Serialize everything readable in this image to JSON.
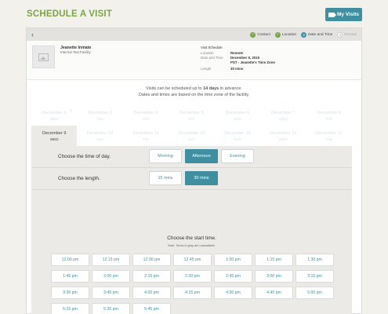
{
  "header": {
    "title": "SCHEDULE A VISIT",
    "my_visits_label": "My Visits"
  },
  "steps": [
    {
      "label": "Contact",
      "state": "done",
      "marker": "✓"
    },
    {
      "label": "Location",
      "state": "done",
      "marker": "✓"
    },
    {
      "label": "Date and Time",
      "state": "current",
      "marker": "3"
    },
    {
      "label": "Review",
      "state": "todo",
      "marker": "4"
    }
  ],
  "inmate": {
    "name": "Jeanette Inmate",
    "facility": "Internal Test Facility"
  },
  "visit_schedule": {
    "title": "Visit Schedule",
    "location_label": "Location",
    "location_value": "Remote",
    "datetime_label": "Date and Time",
    "date_value": "December 9, 2015",
    "tz_value": "PST - Jeanette's Time Zone",
    "length_label": "Length",
    "length_value": "30 mins"
  },
  "info": {
    "line1_pre": "Visits can be scheduled up to ",
    "line1_bold": "14 days",
    "line1_post": " in advance.",
    "line2": "Dates and times are based on the time zone of the facility."
  },
  "dates_row1": [
    {
      "date": "December 2",
      "dow": "WED"
    },
    {
      "date": "December 3",
      "dow": "THU"
    },
    {
      "date": "December 4",
      "dow": "FRI"
    },
    {
      "date": "December 5",
      "dow": "SAT"
    },
    {
      "date": "December 6",
      "dow": "SUN"
    },
    {
      "date": "December 7",
      "dow": "MON"
    },
    {
      "date": "December 8",
      "dow": "TUE"
    }
  ],
  "dates_row2": [
    {
      "date": "December 9",
      "dow": "WED"
    },
    {
      "date": "December 10",
      "dow": "THU"
    },
    {
      "date": "December 11",
      "dow": "FRI"
    },
    {
      "date": "December 12",
      "dow": "SAT"
    },
    {
      "date": "December 13",
      "dow": "SUN"
    },
    {
      "date": "December 14",
      "dow": "MON"
    },
    {
      "date": "December 15",
      "dow": "TUE"
    }
  ],
  "selected_date": "December 9",
  "time_of_day": {
    "label": "Choose the time of day.",
    "options": [
      "Morning",
      "Afternoon",
      "Evening"
    ],
    "selected": "Afternoon"
  },
  "length": {
    "label": "Choose the length.",
    "options": [
      "15 mins",
      "30 mins"
    ],
    "selected": "30 mins"
  },
  "start": {
    "title": "Choose the start time.",
    "note": "Note: Times in gray are unavailable.",
    "times": [
      "12:00 pm",
      "12:15 pm",
      "12:30 pm",
      "12:45 pm",
      "1:00 pm",
      "1:15 pm",
      "1:30 pm",
      "1:45 pm",
      "2:00 pm",
      "2:15 pm",
      "2:30 pm",
      "2:45 pm",
      "3:00 pm",
      "3:15 pm",
      "3:30 pm",
      "3:45 pm",
      "4:00 pm",
      "4:15 pm",
      "4:30 pm",
      "4:45 pm",
      "5:00 pm",
      "5:15 pm",
      "5:30 pm",
      "5:45 pm"
    ]
  },
  "colors": {
    "accent": "#3f8fa0",
    "brand_green": "#7ba545"
  }
}
